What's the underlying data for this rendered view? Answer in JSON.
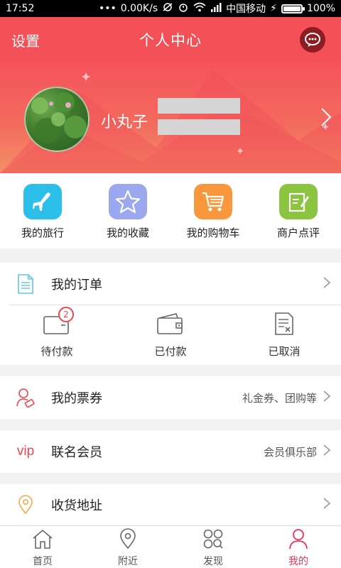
{
  "status_bar": {
    "time": "17:52",
    "network_speed": "0.00K/s",
    "carrier": "中国移动",
    "battery": "100%",
    "battery_level": 1.0
  },
  "header": {
    "left_label": "设置",
    "title": "个人中心",
    "message_icon": "chat-bubble-icon"
  },
  "profile": {
    "username": "小丸子"
  },
  "quick_actions": [
    {
      "label": "我的旅行",
      "icon": "airplane-icon",
      "color": "#2cbfe9"
    },
    {
      "label": "我的收藏",
      "icon": "star-icon",
      "color": "#9ba7ef"
    },
    {
      "label": "我的购物车",
      "icon": "shopping-cart-icon",
      "color": "#f8973b"
    },
    {
      "label": "商户点评",
      "icon": "edit-note-icon",
      "color": "#8bc43f"
    }
  ],
  "orders": {
    "title": "我的订单",
    "statuses": [
      {
        "label": "待付款",
        "icon": "card-icon",
        "badge": "2"
      },
      {
        "label": "已付款",
        "icon": "wallet-icon"
      },
      {
        "label": "已取消",
        "icon": "cancelled-doc-icon"
      }
    ]
  },
  "tickets": {
    "title": "我的票券",
    "extra": "礼金券、团购等"
  },
  "member": {
    "icon_text": "vip",
    "title": "联名会员",
    "extra": "会员俱乐部"
  },
  "address": {
    "title": "收货地址"
  },
  "bottom_nav": [
    {
      "label": "首页",
      "icon": "home-icon",
      "active": false
    },
    {
      "label": "附近",
      "icon": "location-pin-icon",
      "active": false
    },
    {
      "label": "发现",
      "icon": "discover-grid-icon",
      "active": false
    },
    {
      "label": "我的",
      "icon": "user-icon",
      "active": true
    }
  ],
  "colors": {
    "accent": "#f45057",
    "active_nav": "#f0335a",
    "badge": "#f0454e"
  }
}
